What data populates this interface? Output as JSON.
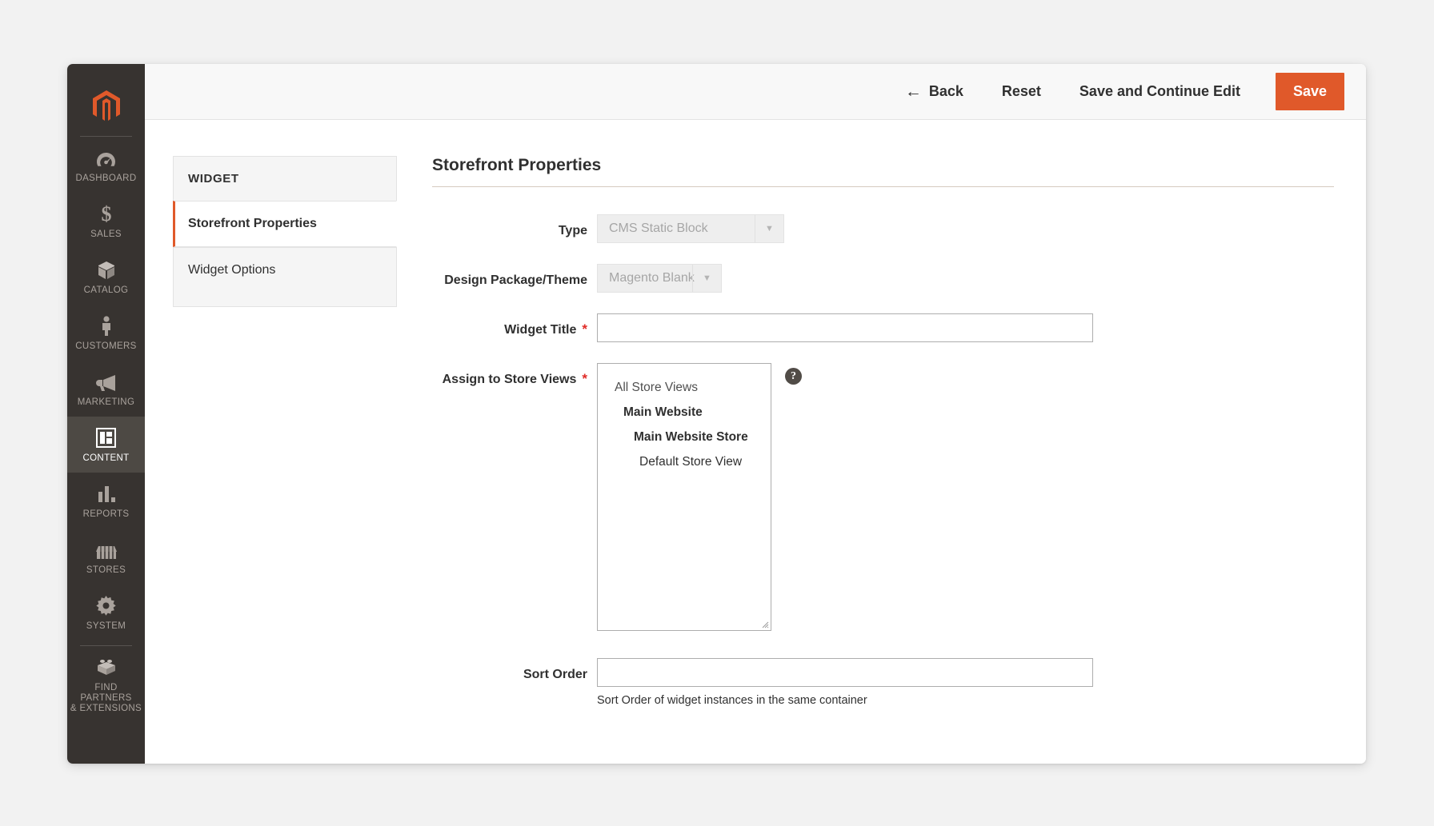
{
  "window": {
    "brand_color": "#e0592a",
    "sidebar_bg": "#373330"
  },
  "sidebar": {
    "logo_name": "magento-logo",
    "items": [
      {
        "id": "dashboard",
        "label": "DASHBOARD",
        "icon": "dashboard-gauge-icon",
        "active": false
      },
      {
        "id": "sales",
        "label": "SALES",
        "icon": "dollar-sign-icon",
        "active": false
      },
      {
        "id": "catalog",
        "label": "CATALOG",
        "icon": "box-icon",
        "active": false
      },
      {
        "id": "customers",
        "label": "CUSTOMERS",
        "icon": "person-icon",
        "active": false
      },
      {
        "id": "marketing",
        "label": "MARKETING",
        "icon": "megaphone-icon",
        "active": false
      },
      {
        "id": "content",
        "label": "CONTENT",
        "icon": "layout-blocks-icon",
        "active": true
      },
      {
        "id": "reports",
        "label": "REPORTS",
        "icon": "bar-chart-icon",
        "active": false
      },
      {
        "id": "stores",
        "label": "STORES",
        "icon": "storefront-awning-icon",
        "active": false
      },
      {
        "id": "system",
        "label": "SYSTEM",
        "icon": "gear-icon",
        "active": false
      },
      {
        "id": "find-partners",
        "label": "FIND PARTNERS\n& EXTENSIONS",
        "icon": "lego-brick-icon",
        "active": false
      }
    ]
  },
  "header": {
    "back_label": "Back",
    "back_icon": "arrow-left-icon",
    "reset_label": "Reset",
    "save_continue_label": "Save and Continue Edit",
    "save_label": "Save"
  },
  "widget_nav": {
    "heading": "WIDGET",
    "items": [
      {
        "label": "Storefront Properties",
        "active": true
      },
      {
        "label": "Widget Options",
        "active": false
      }
    ]
  },
  "form": {
    "section_title": "Storefront Properties",
    "type": {
      "label": "Type",
      "value": "CMS Static Block",
      "disabled": true,
      "arrow_icon": "chevron-down-icon"
    },
    "design_theme": {
      "label": "Design Package/Theme",
      "value": "Magento Blank",
      "disabled": true,
      "arrow_icon": "chevron-down-icon"
    },
    "widget_title": {
      "label": "Widget Title",
      "required_marker": "*",
      "value": "",
      "placeholder": ""
    },
    "store_views": {
      "label": "Assign to Store Views",
      "required_marker": "*",
      "help_icon": "question-mark-help-icon",
      "resize_handle_icon": "resize-grip-icon",
      "options": [
        {
          "label": "All Store Views",
          "level": 0
        },
        {
          "label": "Main Website",
          "level": 1
        },
        {
          "label": "Main Website Store",
          "level": 2
        },
        {
          "label": "Default Store View",
          "level": 3
        }
      ]
    },
    "sort_order": {
      "label": "Sort Order",
      "value": "",
      "placeholder": "",
      "note": "Sort Order of widget instances in the same container"
    }
  }
}
